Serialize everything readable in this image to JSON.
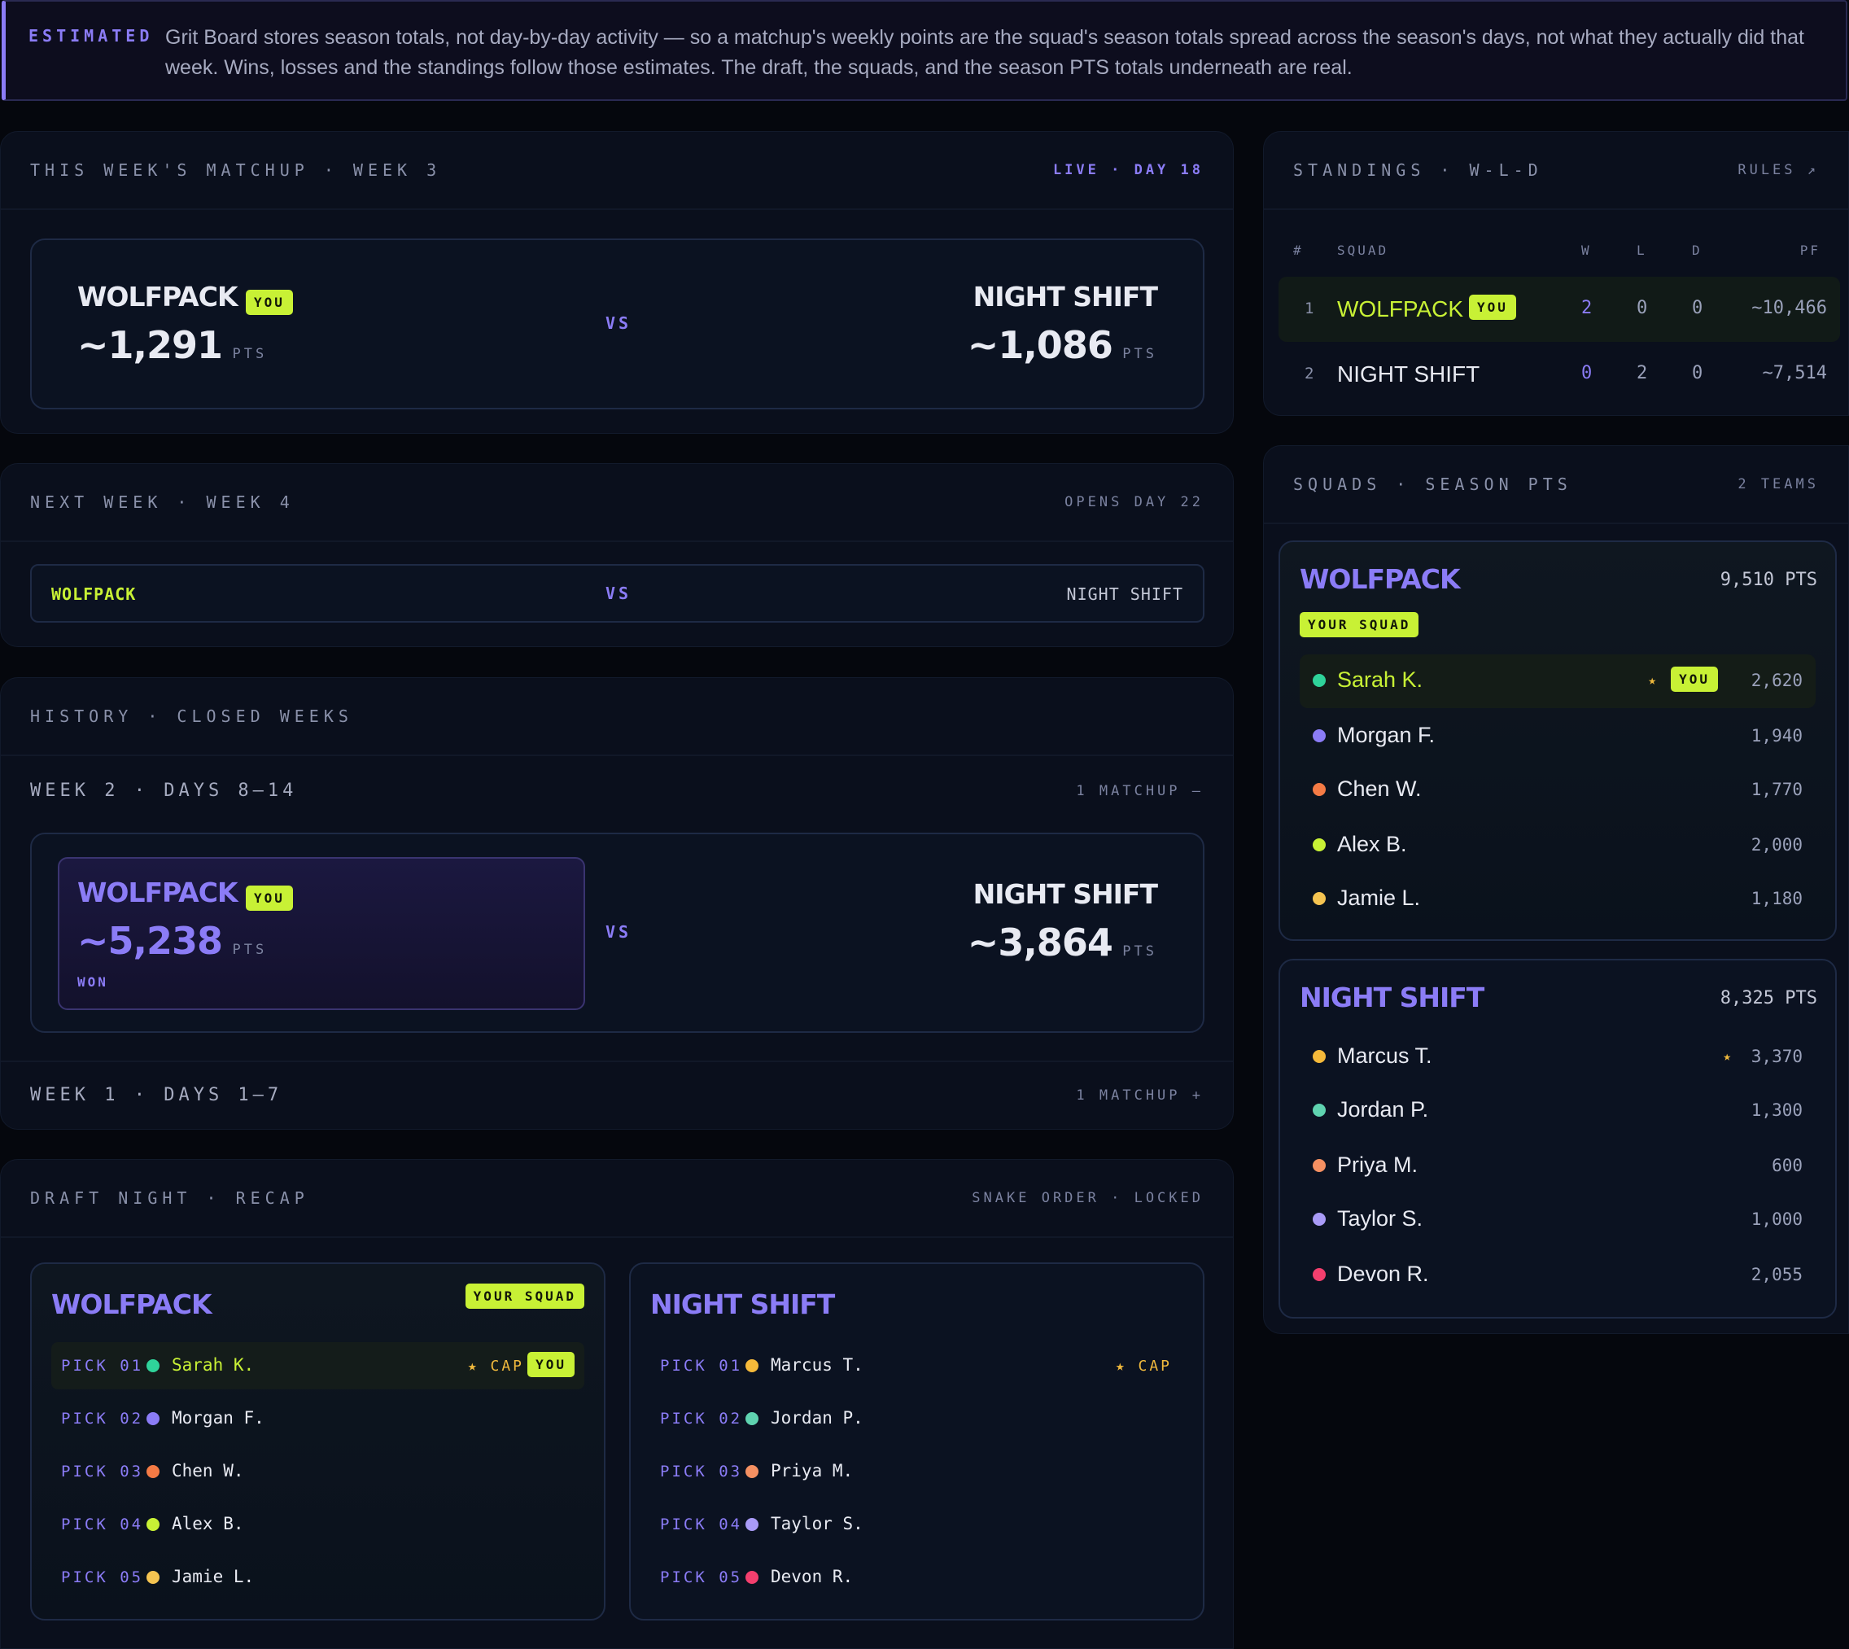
{
  "banner": {
    "tag": "ESTIMATED",
    "text": "Grit Board stores season totals, not day-by-day activity — so a matchup's weekly points are the squad's season totals spread across the season's days, not what they actually did that week. Wins, losses and the standings follow those estimates. The draft, the squads, and the season PTS totals underneath are real."
  },
  "matchup": {
    "title": "THIS WEEK'S MATCHUP · WEEK 3",
    "status": "LIVE · DAY 18",
    "home_name": "WOLFPACK",
    "home_badge": "YOU",
    "home_pts": "~1,291",
    "away_name": "NIGHT SHIFT",
    "away_pts": "~1,086",
    "pts_label": "PTS",
    "vs": "VS"
  },
  "next_week": {
    "title": "NEXT WEEK · WEEK 4",
    "status": "OPENS DAY 22",
    "home_name": "WOLFPACK",
    "away_name": "NIGHT SHIFT",
    "vs": "VS"
  },
  "history": {
    "title": "HISTORY · CLOSED WEEKS",
    "weeks": [
      {
        "label": "WEEK 2 · DAYS 8–14",
        "meta": "1 MATCHUP –",
        "home_name": "WOLFPACK",
        "home_badge": "YOU",
        "home_pts": "~5,238",
        "result": "WON",
        "away_name": "NIGHT SHIFT",
        "away_pts": "~3,864",
        "pts_label": "PTS",
        "vs": "VS"
      },
      {
        "label": "WEEK 1 · DAYS 1–7",
        "meta": "1 MATCHUP +"
      }
    ]
  },
  "draft": {
    "title": "DRAFT NIGHT · RECAP",
    "status": "SNAKE ORDER · LOCKED",
    "teams": [
      {
        "name": "WOLFPACK",
        "badge": "YOUR SQUAD",
        "picks": [
          {
            "pick": "PICK 01",
            "name": "Sarah K.",
            "color": "#2fd39a",
            "cap": "★ CAP",
            "you": "YOU"
          },
          {
            "pick": "PICK 02",
            "name": "Morgan F.",
            "color": "#8b7cf6"
          },
          {
            "pick": "PICK 03",
            "name": "Chen W.",
            "color": "#f57b45"
          },
          {
            "pick": "PICK 04",
            "name": "Alex B.",
            "color": "#c8f135"
          },
          {
            "pick": "PICK 05",
            "name": "Jamie L.",
            "color": "#f5c451"
          }
        ]
      },
      {
        "name": "NIGHT SHIFT",
        "picks": [
          {
            "pick": "PICK 01",
            "name": "Marcus T.",
            "color": "#f5b93a",
            "cap": "★ CAP"
          },
          {
            "pick": "PICK 02",
            "name": "Jordan P.",
            "color": "#5fd3b0"
          },
          {
            "pick": "PICK 03",
            "name": "Priya M.",
            "color": "#f59062"
          },
          {
            "pick": "PICK 04",
            "name": "Taylor S.",
            "color": "#a99bf7"
          },
          {
            "pick": "PICK 05",
            "name": "Devon R.",
            "color": "#f43f6e"
          }
        ]
      }
    ]
  },
  "standings": {
    "title": "STANDINGS · W-L-D",
    "link": "RULES ↗",
    "headers": {
      "rank": "#",
      "squad": "SQUAD",
      "w": "W",
      "l": "L",
      "d": "D",
      "pf": "PF"
    },
    "rows": [
      {
        "rank": "1",
        "squad": "WOLFPACK",
        "badge": "YOU",
        "w": "2",
        "l": "0",
        "d": "0",
        "pf": "~10,466"
      },
      {
        "rank": "2",
        "squad": "NIGHT SHIFT",
        "w": "0",
        "l": "2",
        "d": "0",
        "pf": "~7,514"
      }
    ]
  },
  "squads": {
    "title": "SQUADS · SEASON PTS",
    "count": "2 TEAMS",
    "teams": [
      {
        "name": "WOLFPACK",
        "total": "9,510 PTS",
        "badge": "YOUR SQUAD",
        "players": [
          {
            "name": "Sarah K.",
            "color": "#2fd39a",
            "pts": "2,620",
            "star": "★",
            "you": "YOU"
          },
          {
            "name": "Morgan F.",
            "color": "#8b7cf6",
            "pts": "1,940"
          },
          {
            "name": "Chen W.",
            "color": "#f57b45",
            "pts": "1,770"
          },
          {
            "name": "Alex B.",
            "color": "#c8f135",
            "pts": "2,000"
          },
          {
            "name": "Jamie L.",
            "color": "#f5c451",
            "pts": "1,180"
          }
        ]
      },
      {
        "name": "NIGHT SHIFT",
        "total": "8,325 PTS",
        "players": [
          {
            "name": "Marcus T.",
            "color": "#f5b93a",
            "pts": "3,370",
            "star": "★"
          },
          {
            "name": "Jordan P.",
            "color": "#5fd3b0",
            "pts": "1,300"
          },
          {
            "name": "Priya M.",
            "color": "#f59062",
            "pts": "600"
          },
          {
            "name": "Taylor S.",
            "color": "#a99bf7",
            "pts": "1,000"
          },
          {
            "name": "Devon R.",
            "color": "#f43f6e",
            "pts": "2,055"
          }
        ]
      }
    ]
  },
  "colors": {
    "accent": "#8b7cf6",
    "lime": "#c8f135",
    "gold": "#f0b93d"
  }
}
